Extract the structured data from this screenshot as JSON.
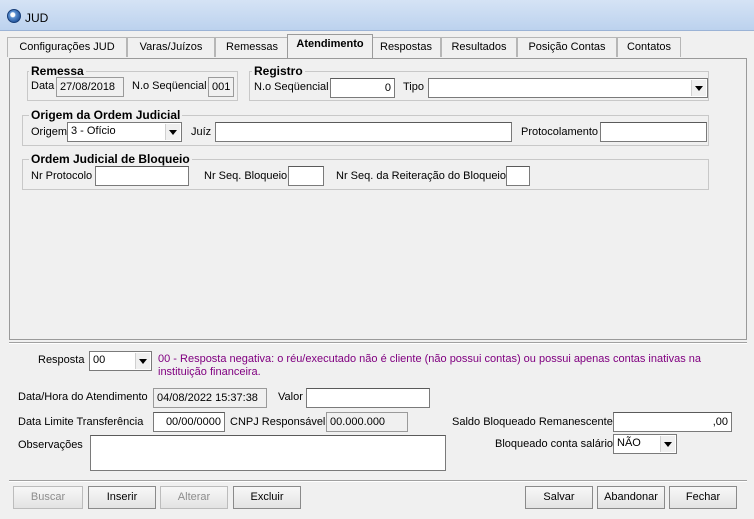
{
  "window": {
    "title": "JUD"
  },
  "tabs": [
    "Configurações JUD",
    "Varas/Juízos",
    "Remessas",
    "Atendimento",
    "Respostas",
    "Resultados",
    "Posição Contas",
    "Contatos"
  ],
  "remessa": {
    "title": "Remessa",
    "data_label": "Data",
    "data_value": "27/08/2018",
    "seq_label": "N.o Seqüencial",
    "seq_value": "001"
  },
  "registro": {
    "title": "Registro",
    "seq_label": "N.o Seqüencial",
    "seq_value": "0",
    "tipo_label": "Tipo",
    "tipo_value": ""
  },
  "origem": {
    "title": "Origem da Ordem Judicial",
    "origem_label": "Origem",
    "origem_value": "3 - Ofício",
    "juiz_label": "Juíz",
    "juiz_value": "",
    "protocolamento_label": "Protocolamento",
    "protocolamento_value": ""
  },
  "bloqueio": {
    "title": "Ordem Judicial de Bloqueio",
    "protocolo_label": "Nr Protocolo",
    "protocolo_value": "",
    "seqbloq_label": "Nr Seq. Bloqueio",
    "seqbloq_value": "",
    "reiteracao_label": "Nr Seq. da Reiteração do Bloqueio",
    "reiteracao_value": ""
  },
  "bottom": {
    "resposta_label": "Resposta",
    "resposta_value": "00",
    "resposta_message": "00 - Resposta negativa: o réu/executado não é cliente (não possui contas) ou possui apenas contas inativas na instituição financeira.",
    "atendimento_label": "Data/Hora do Atendimento",
    "atendimento_value": "04/08/2022 15:37:38",
    "valor_label": "Valor",
    "valor_value": "",
    "limite_label": "Data Limite Transferência",
    "limite_value": "00/00/0000",
    "cnpj_label": "CNPJ Responsável",
    "cnpj_value": "00.000.000",
    "saldo_label": "Saldo Bloqueado Remanescente",
    "saldo_value": ",00",
    "obs_label": "Observações",
    "obs_value": "",
    "salario_label": "Bloqueado conta salário",
    "salario_value": "NÃO"
  },
  "buttons": {
    "buscar": "Buscar",
    "inserir": "Inserir",
    "alterar": "Alterar",
    "excluir": "Excluir",
    "salvar": "Salvar",
    "abandonar": "Abandonar",
    "fechar": "Fechar"
  }
}
